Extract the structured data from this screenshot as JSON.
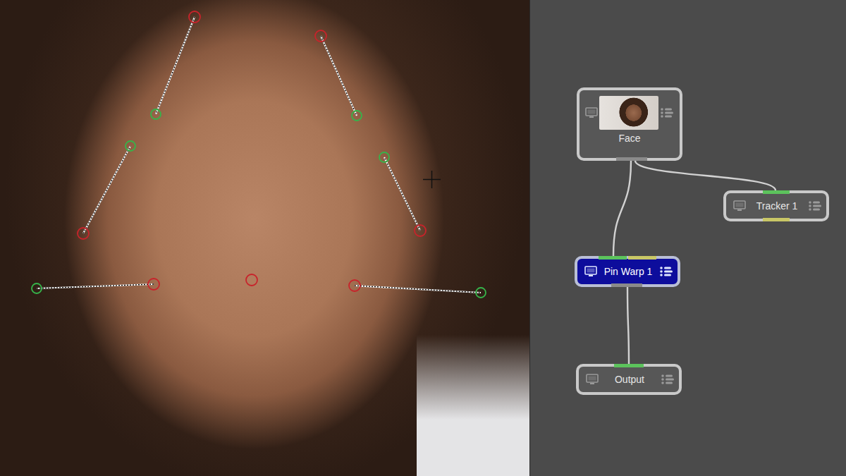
{
  "viewer": {
    "pins": [
      {
        "kind": "pair",
        "source_color": "#c8232b",
        "target_color": "#36b44a"
      },
      {
        "kind": "pair",
        "source_color": "#c8232b",
        "target_color": "#36b44a"
      },
      {
        "kind": "pair",
        "source_color": "#c8232b",
        "target_color": "#36b44a"
      },
      {
        "kind": "pair",
        "source_color": "#c8232b",
        "target_color": "#36b44a"
      },
      {
        "kind": "pair",
        "source_color": "#c8232b",
        "target_color": "#36b44a"
      },
      {
        "kind": "pair",
        "source_color": "#c8232b",
        "target_color": "#36b44a"
      },
      {
        "kind": "single",
        "source_color": "#c8232b"
      }
    ]
  },
  "nodes": [
    {
      "label": "Face",
      "kind": "source",
      "selected": false
    },
    {
      "label": "Tracker 1",
      "kind": "process",
      "selected": false
    },
    {
      "label": "Pin Warp 1",
      "kind": "process",
      "selected": true
    },
    {
      "label": "Output",
      "kind": "output",
      "selected": false
    }
  ],
  "links": [
    {
      "from": 0,
      "to": 2
    },
    {
      "from": 0,
      "to": 1
    },
    {
      "from": 2,
      "to": 3
    }
  ]
}
